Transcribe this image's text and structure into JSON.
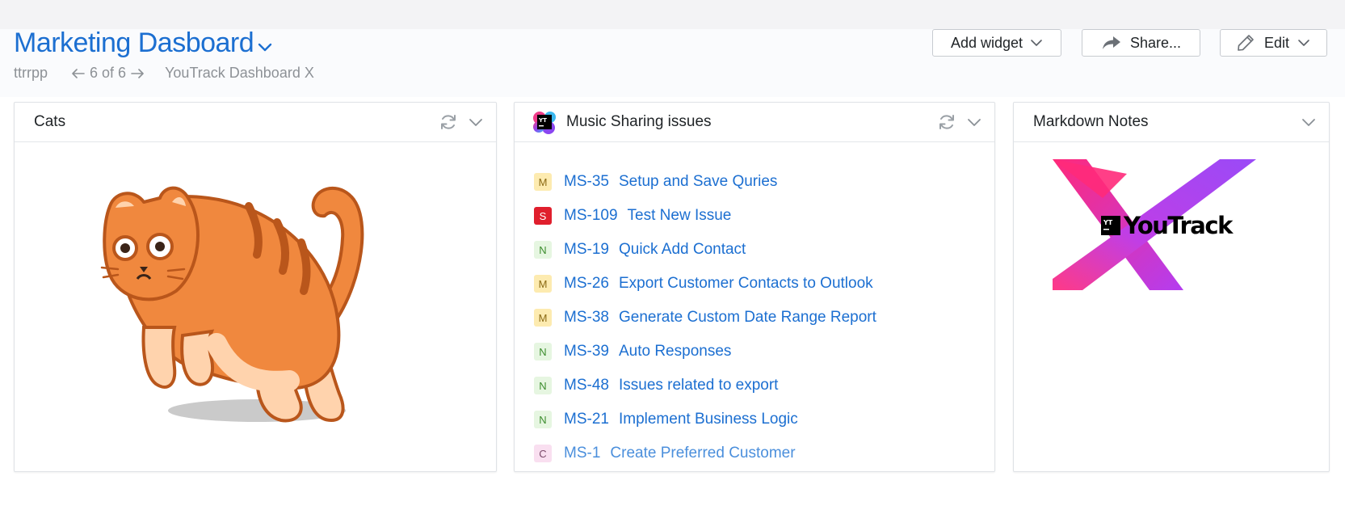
{
  "dashboard": {
    "title": "Marketing Dasboard",
    "owner": "ttrrpp",
    "pager": "6 of 6",
    "next_dashboard": "YouTrack Dashboard X"
  },
  "toolbar": {
    "add_widget_label": "Add widget",
    "share_label": "Share...",
    "edit_label": "Edit"
  },
  "widgets": {
    "cats": {
      "title": "Cats"
    },
    "music": {
      "title": "Music Sharing issues",
      "logo_text": "YT",
      "issues": [
        {
          "priority": "M",
          "id": "MS-35",
          "summary": "Setup and Save Quries"
        },
        {
          "priority": "S",
          "id": "MS-109",
          "summary": "Test New Issue"
        },
        {
          "priority": "N",
          "id": "MS-19",
          "summary": "Quick Add Contact"
        },
        {
          "priority": "M",
          "id": "MS-26",
          "summary": "Export Customer Contacts to Outlook"
        },
        {
          "priority": "M",
          "id": "MS-38",
          "summary": "Generate Custom Date Range Report"
        },
        {
          "priority": "N",
          "id": "MS-39",
          "summary": "Auto Responses"
        },
        {
          "priority": "N",
          "id": "MS-48",
          "summary": "Issues related to export"
        },
        {
          "priority": "N",
          "id": "MS-21",
          "summary": "Implement Business Logic"
        },
        {
          "priority": "C",
          "id": "MS-1",
          "summary": "Create Preferred Customer"
        }
      ]
    },
    "notes": {
      "title": "Markdown Notes",
      "logo_mark": "YT",
      "logo_text": "YouTrack"
    }
  },
  "colors": {
    "link": "#1c6fd1",
    "priority_major": "#fdebb0",
    "priority_show_stopper": "#e01f2d",
    "priority_normal": "#e6f6e1",
    "priority_critical": "#f9dff0"
  }
}
